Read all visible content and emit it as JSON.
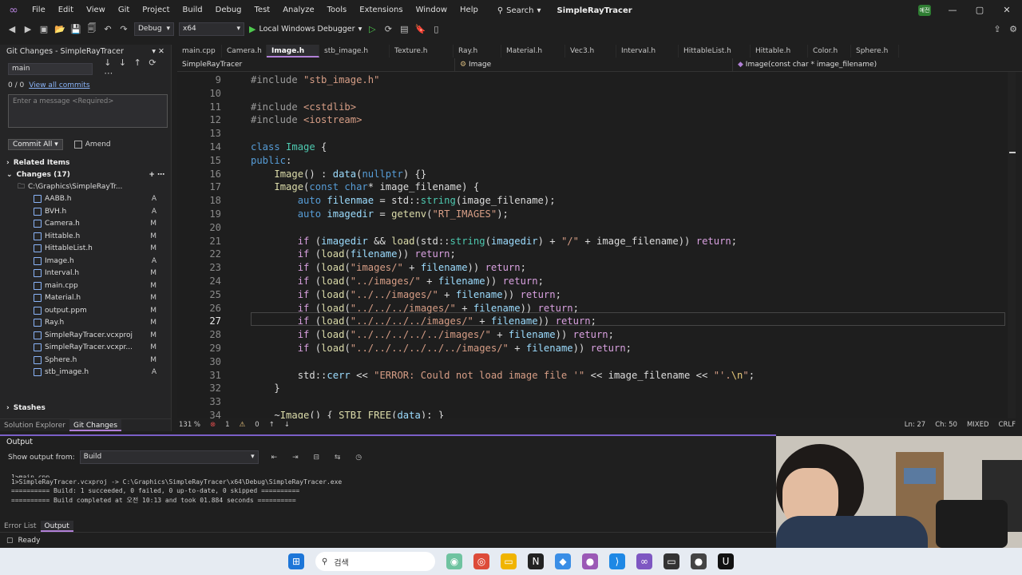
{
  "titlebar": {
    "menus": [
      "File",
      "Edit",
      "View",
      "Git",
      "Project",
      "Build",
      "Debug",
      "Test",
      "Analyze",
      "Tools",
      "Extensions",
      "Window",
      "Help"
    ],
    "search": "Search",
    "solution": "SimpleRayTracer",
    "user_badge": "예전"
  },
  "toolbar": {
    "config": "Debug",
    "platform": "x64",
    "run_label": "Local Windows Debugger"
  },
  "git": {
    "title": "Git Changes - SimpleRayTracer",
    "branch": "main",
    "counts": "0 / 0",
    "view_all": "View all commits",
    "message_placeholder": "Enter a message <Required>",
    "commit_all": "Commit All",
    "amend": "Amend",
    "related": "Related Items",
    "changes": "Changes (17)",
    "repo_path": "C:\\Graphics\\SimpleRayTr...",
    "files": [
      {
        "name": "AABB.h",
        "status": "A"
      },
      {
        "name": "BVH.h",
        "status": "A"
      },
      {
        "name": "Camera.h",
        "status": "M"
      },
      {
        "name": "Hittable.h",
        "status": "M"
      },
      {
        "name": "HittableList.h",
        "status": "M"
      },
      {
        "name": "Image.h",
        "status": "A"
      },
      {
        "name": "Interval.h",
        "status": "M"
      },
      {
        "name": "main.cpp",
        "status": "M"
      },
      {
        "name": "Material.h",
        "status": "M"
      },
      {
        "name": "output.ppm",
        "status": "M"
      },
      {
        "name": "Ray.h",
        "status": "M"
      },
      {
        "name": "SimpleRayTracer.vcxproj",
        "status": "M"
      },
      {
        "name": "SimpleRayTracer.vcxpr...",
        "status": "M"
      },
      {
        "name": "Sphere.h",
        "status": "M"
      },
      {
        "name": "stb_image.h",
        "status": "A"
      }
    ],
    "stashes": "Stashes",
    "tab_solution": "Solution Explorer",
    "tab_git": "Git Changes"
  },
  "tabs": [
    "main.cpp",
    "Camera.h",
    "Image.h",
    "stb_image.h",
    "Texture.h",
    "Ray.h",
    "Material.h",
    "Vec3.h",
    "Interval.h",
    "HittableList.h",
    "Hittable.h",
    "Color.h",
    "Sphere.h"
  ],
  "nav": {
    "project": "SimpleRayTracer",
    "scope": "Image",
    "member": "Image(const char * image_filename)"
  },
  "editor_status": {
    "zoom": "131 %",
    "errors": "1",
    "warnings": "0",
    "ln": "Ln: 27",
    "ch": "Ch: 50",
    "enc": "MIXED",
    "eol": "CRLF"
  },
  "output": {
    "title": "Output",
    "show_from": "Show output from:",
    "source": "Build",
    "lines": [
      "1>main.cpp",
      "1>SimpleRayTracer.vcxproj -> C:\\Graphics\\SimpleRayTracer\\x64\\Debug\\SimpleRayTracer.exe",
      "========== Build: 1 succeeded, 0 failed, 0 up-to-date, 0 skipped ==========",
      "========== Build completed at 오전 10:13 and took 01.884 seconds =========="
    ],
    "tab_errors": "Error List",
    "tab_output": "Output"
  },
  "status": {
    "ready": "Ready"
  },
  "taskbar": {
    "search": "검색"
  },
  "colors": {
    "accent": "#b180d7",
    "editor_bg": "#1e1e1e"
  }
}
